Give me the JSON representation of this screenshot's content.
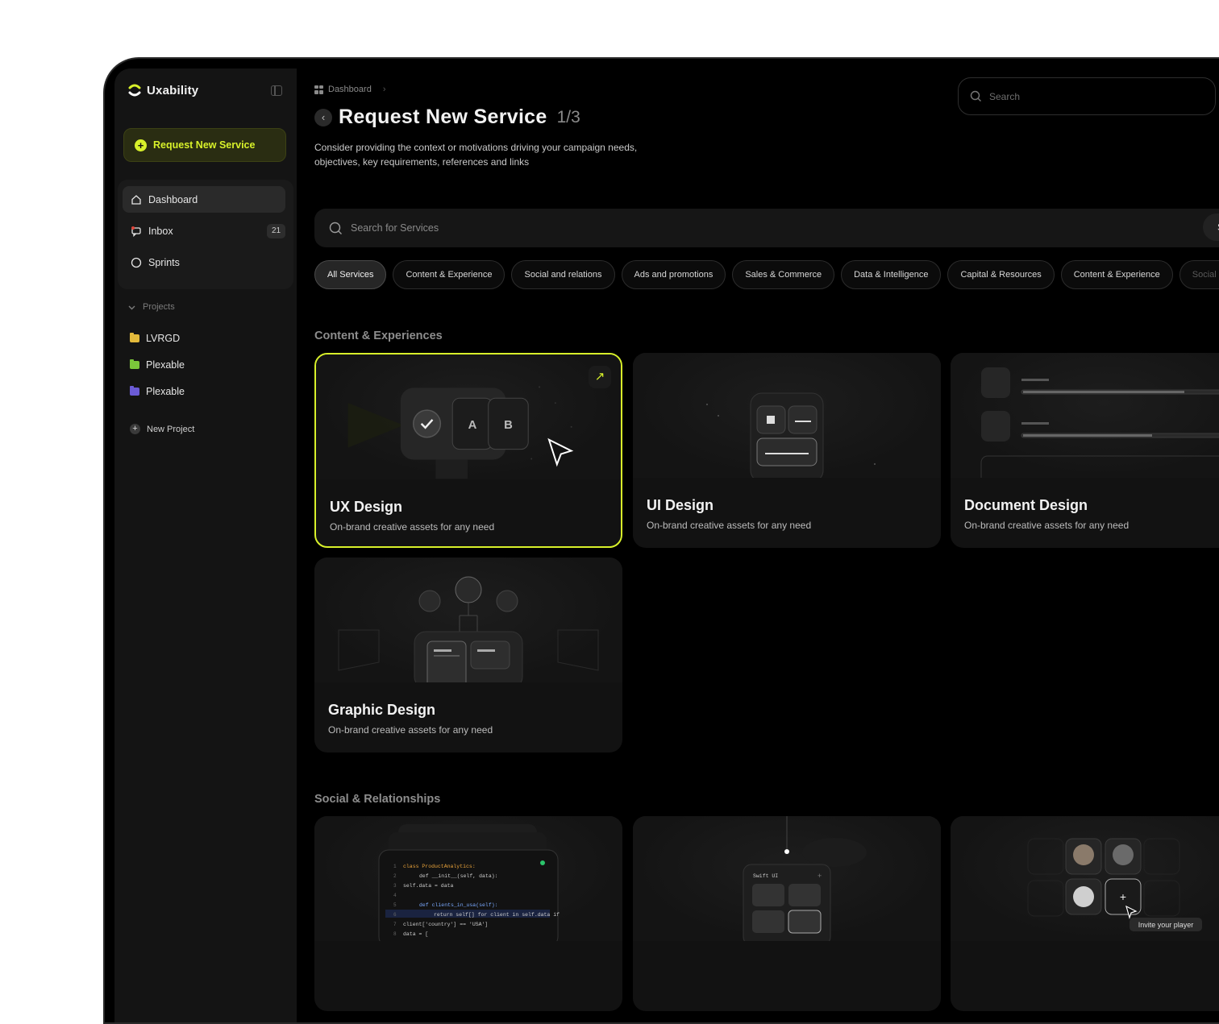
{
  "brand": {
    "name": "Uxability",
    "accent": "#d8f12a"
  },
  "sidebar": {
    "request_button": "Request New Service",
    "nav": [
      {
        "label": "Dashboard",
        "icon": "home-icon",
        "active": true
      },
      {
        "label": "Inbox",
        "icon": "inbox-icon",
        "badge": "21"
      },
      {
        "label": "Sprints",
        "icon": "circle-icon"
      }
    ],
    "projects_label": "Projects",
    "projects": [
      {
        "label": "LVRGD",
        "color": "#e2b93b"
      },
      {
        "label": "Plexable",
        "color": "#7bc63a"
      },
      {
        "label": "Plexable",
        "color": "#6b5bd6"
      }
    ],
    "new_project": "New Project"
  },
  "header": {
    "breadcrumb": "Dashboard",
    "title": "Request New Service",
    "step": "1/3",
    "subtitle": "Consider providing the context or motivations driving your campaign needs, objectives, key requirements, references and links",
    "search_placeholder": "Search"
  },
  "service_search": {
    "placeholder": "Search for Services",
    "button": "Search"
  },
  "chips": [
    {
      "label": "All Services",
      "active": true
    },
    {
      "label": "Content & Experience"
    },
    {
      "label": "Social and relations"
    },
    {
      "label": "Ads and promotions"
    },
    {
      "label": "Sales & Commerce"
    },
    {
      "label": "Data & Intelligence"
    },
    {
      "label": "Capital & Resources"
    },
    {
      "label": "Content & Experience"
    },
    {
      "label": "Social and relations"
    }
  ],
  "sections": [
    {
      "title": "Content & Experiences",
      "cards": [
        {
          "title": "UX Design",
          "desc": "On-brand creative assets for any need",
          "selected": true
        },
        {
          "title": "UI Design",
          "desc": "On-brand creative assets for any need"
        },
        {
          "title": "Document Design",
          "desc": "On-brand creative assets for any need"
        },
        {
          "title": "Graphic Design",
          "desc": "On-brand creative assets for any need"
        }
      ]
    },
    {
      "title": "Social & Relationships",
      "cards": [
        {
          "title": "",
          "desc": ""
        },
        {
          "title": "",
          "desc": ""
        },
        {
          "title": "",
          "desc": ""
        }
      ]
    }
  ],
  "art": {
    "ux_keys": [
      "A",
      "B"
    ],
    "code_lines": [
      "class ProductAnalytics:",
      "def __init__(self, data):",
      "self.data = data",
      "",
      "def clients_in_usa(self):",
      "return self[] for client in self.data if",
      "client['country'] == 'USA']",
      "data = ["
    ],
    "swift_label": "Swift UI",
    "invite_label": "Invite your player"
  }
}
